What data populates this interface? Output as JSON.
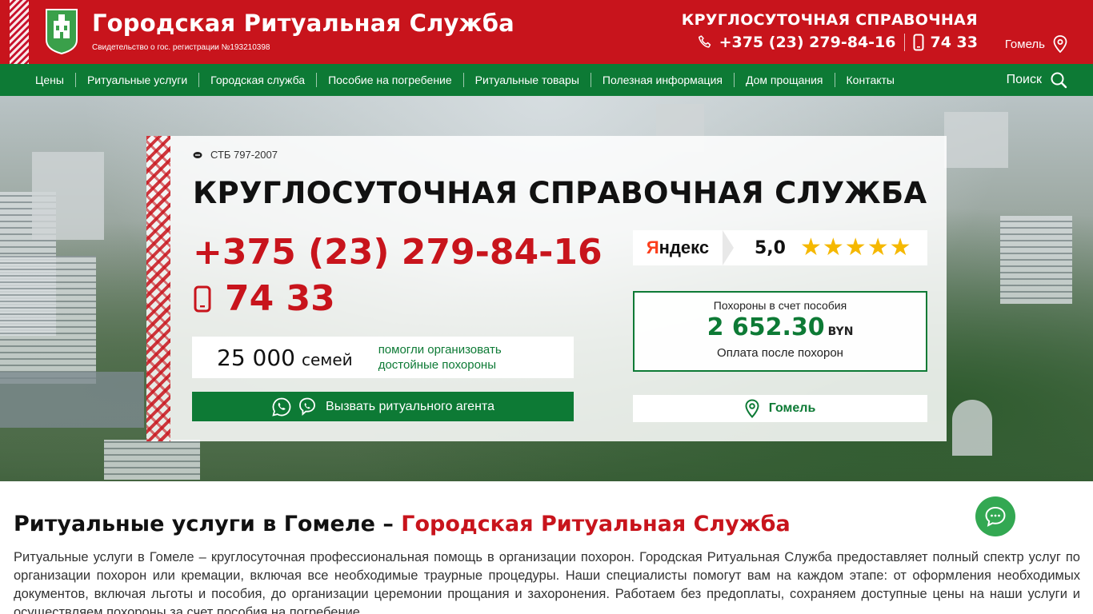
{
  "header": {
    "brand_title": "Городская Ритуальная Служба",
    "brand_subtitle": "Свидетельство о гос. регистрации №193210398",
    "hotline_title": "КРУГЛОСУТОЧНАЯ СПРАВОЧНАЯ",
    "phone": "+375 (23) 279-84-16",
    "short_phone": "74 33",
    "city": "Гомель"
  },
  "nav": {
    "items": [
      {
        "label": "Цены"
      },
      {
        "label": "Ритуальные услуги"
      },
      {
        "label": "Городская служба"
      },
      {
        "label": "Пособие на погребение"
      },
      {
        "label": "Ритуальные товары"
      },
      {
        "label": "Полезная информация"
      },
      {
        "label": "Дом прощания"
      },
      {
        "label": "Контакты"
      }
    ],
    "search_label": "Поиск"
  },
  "hero": {
    "standard": "СТБ 797-2007",
    "title": "КРУГЛОСУТОЧНАЯ СПРАВОЧНАЯ СЛУЖБА",
    "phone": "+375 (23) 279-84-16",
    "short_phone": "74 33",
    "families_number": "25 000",
    "families_unit": "семей",
    "families_note_1": "помогли организовать",
    "families_note_2": "достойные похороны",
    "call_button": "Вызвать ритуального агента",
    "rating": {
      "source": "Яндекс",
      "score": "5,0",
      "stars": 5
    },
    "benefit": {
      "label": "Похороны в счет пособия",
      "amount": "2 652.30",
      "currency": "BYN",
      "note": "Оплата после похорон"
    },
    "city_button": "Гомель"
  },
  "content": {
    "heading_main": "Ритуальные услуги в Гомеле – ",
    "heading_accent": "Городская Ритуальная Служба",
    "paragraph": "Ритуальные услуги в Гомеле – круглосуточная профессиональная помощь в организации похорон. Городская Ритуальная Служба предоставляет полный спектр услуг по организации похорон или кремации, включая все необходимые траурные процедуры. Наши специалисты помогут вам на каждом этапе: от оформления необходимых документов, включая льготы и пособия, до организации церемонии прощания и захоронения. Работаем без предоплаты, сохраняем доступные цены на наши услуги и осуществляем похороны за счет пособия на погребение."
  },
  "colors": {
    "brand_red": "#c8141c",
    "brand_green": "#0d7a35",
    "star": "#f5b800"
  },
  "icons": [
    "coat-of-arms-logo",
    "phone-icon",
    "mobile-icon",
    "location-pin-icon",
    "search-icon",
    "whatsapp-icon",
    "viber-icon",
    "chat-icon",
    "std-mark-icon"
  ]
}
